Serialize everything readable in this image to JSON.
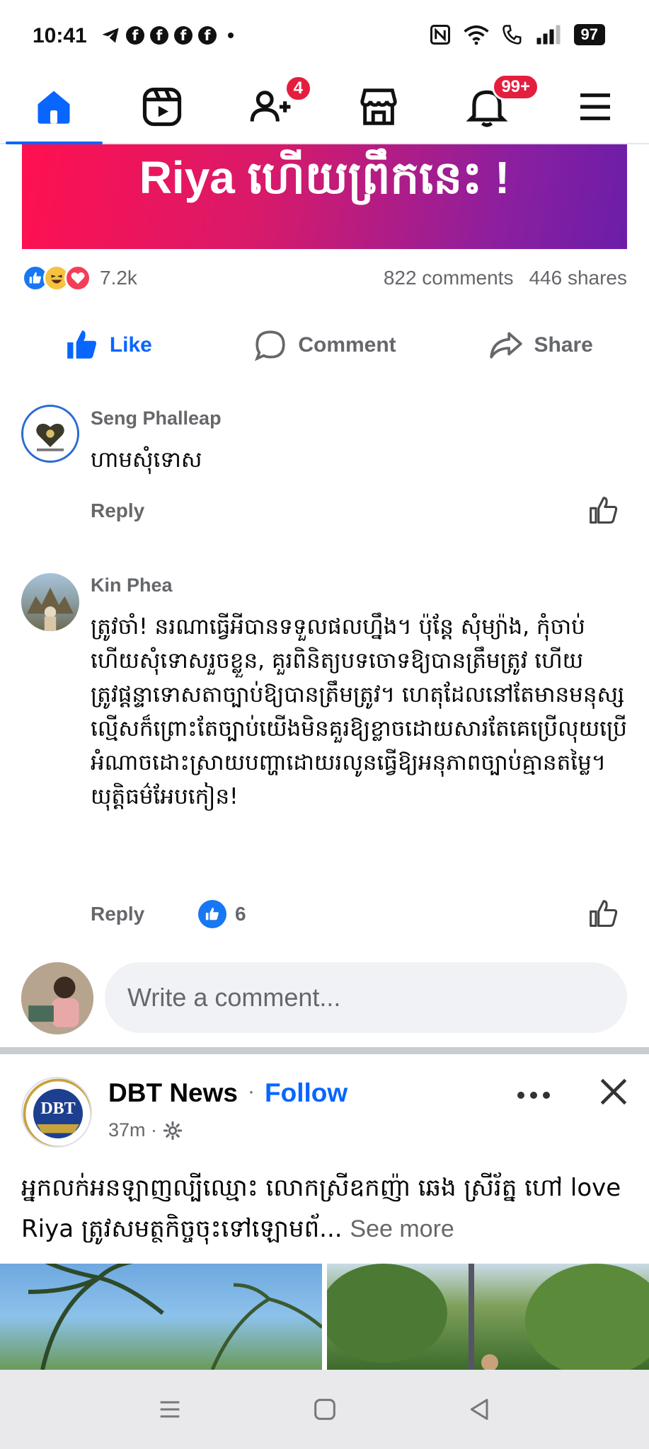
{
  "status_bar": {
    "time": "10:41",
    "left_icons": [
      "telegram-icon",
      "facebook-icon",
      "facebook-icon",
      "facebook-icon",
      "facebook-icon"
    ],
    "battery": "97"
  },
  "nav": {
    "notifications_friends_badge": "4",
    "notifications_bell_badge": "99+"
  },
  "banner": {
    "text": "Riya ហើយព្រឹកនេះ !"
  },
  "post_stats": {
    "reaction_count": "7.2k",
    "comments": "822 comments",
    "shares": "446 shares"
  },
  "actions": {
    "like": "Like",
    "comment": "Comment",
    "share": "Share"
  },
  "comments": [
    {
      "name": "Seng Phalleap",
      "text": "ហាមសុំទោស",
      "reply": "Reply"
    },
    {
      "name": "Kin Phea",
      "text": "ត្រូវចាំ! នរណាធ្វើអីបានទទួលផលហ្នឹង។ ប៉ុន្តែ សុំម្យ៉ាង, កុំចាប់ហើយសុំទោសរួចខ្លួន, គួរពិនិត្យបទចោទឱ្យបានត្រឹមត្រូវ ហើយត្រូវផ្តន្ទាទោសតាច្បាប់ឱ្យបានត្រឹមត្រូវ។ ហេតុដែលនៅតែមានមនុស្សល្មើសក៏ព្រោះតែច្បាប់យើងមិនគួរឱ្យខ្លាចដោយសារតែគេប្រើលុយប្រើអំណាចដោះស្រាយបញ្ហាដោយរលូនធ្វើឱ្យអនុភាពច្បាប់គ្មានតម្លៃ។ យុត្តិធម៌អែបកៀន!",
      "reply": "Reply",
      "like_count": "6"
    }
  ],
  "write_comment": {
    "placeholder": "Write a comment..."
  },
  "next_post": {
    "page_name": "DBT News",
    "separator": "·",
    "follow": "Follow",
    "time": "37m ·",
    "text": "អ្នកលក់អនឡាញល្បីឈ្មោះ លោកស្រីឧកញ៉ា ឆេង ស្រីរ័ត្ន ហៅ love Riya ត្រូវសមត្ថកិច្ចចុះទៅឡោមព័...",
    "see_more": "See more",
    "logo_text": "DBT"
  },
  "colors": {
    "facebook_blue": "#0866ff",
    "badge_red": "#e41e3f",
    "secondary_text": "#65676b"
  }
}
